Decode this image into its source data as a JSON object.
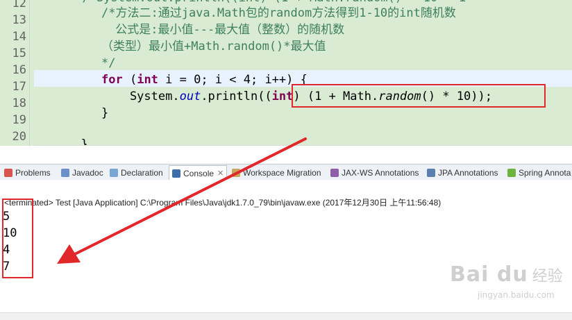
{
  "editor": {
    "line_numbers": [
      "12",
      "13",
      "14",
      "15",
      "16",
      "17",
      "18",
      "19",
      "20"
    ],
    "line12_code": "  /*System.out.println((int) (1 + Math.random() * 10 - 1",
    "line12_comment": "/*方法二:通过java.Math包的random方法得到1-10的int随机数",
    "line13_comment": " 公式是:最小值---最大值（整数）的随机数",
    "line14_comment": "（类型）最小值+Math.random()*最大值",
    "line15_comment": "*/",
    "line16": {
      "kw_for": "for",
      "p1": " (",
      "kw_int": "int",
      "p2": " i = 0; i < 4; i++) {"
    },
    "line17": {
      "p1": "    System.",
      "field": "out",
      "p2": ".println((",
      "kw_int": "int",
      "p3": ") (1 + Math.",
      "method": "random",
      "p4": "() * 10));"
    },
    "line18": "}",
    "line20": "  }"
  },
  "tabs": [
    {
      "label": "Problems",
      "icon": "problems-icon"
    },
    {
      "label": "Javadoc",
      "icon": "javadoc-icon"
    },
    {
      "label": "Declaration",
      "icon": "declaration-icon"
    },
    {
      "label": "Console",
      "icon": "console-icon",
      "active": true
    },
    {
      "label": "Workspace Migration",
      "icon": "migration-icon"
    },
    {
      "label": "JAX-WS Annotations",
      "icon": "jaxws-icon"
    },
    {
      "label": "JPA Annotations",
      "icon": "jpa-icon"
    },
    {
      "label": "Spring Annota",
      "icon": "spring-icon"
    }
  ],
  "tab_close_glyph": "✕",
  "console": {
    "header": "<terminated> Test [Java Application] C:\\Program Files\\Java\\jdk1.7.0_79\\bin\\javaw.exe (2017年12月30日 上午11:56:48)",
    "output": [
      "5",
      "10",
      "4",
      "7"
    ]
  },
  "watermark": {
    "brand": "Bai du",
    "sub": "经验",
    "url": "jingyan.baidu.com"
  },
  "colors": {
    "annotation_red": "#e0282b",
    "editor_bg": "#d9ebd3",
    "keyword": "#7f0055",
    "comment": "#3f7f5f"
  }
}
